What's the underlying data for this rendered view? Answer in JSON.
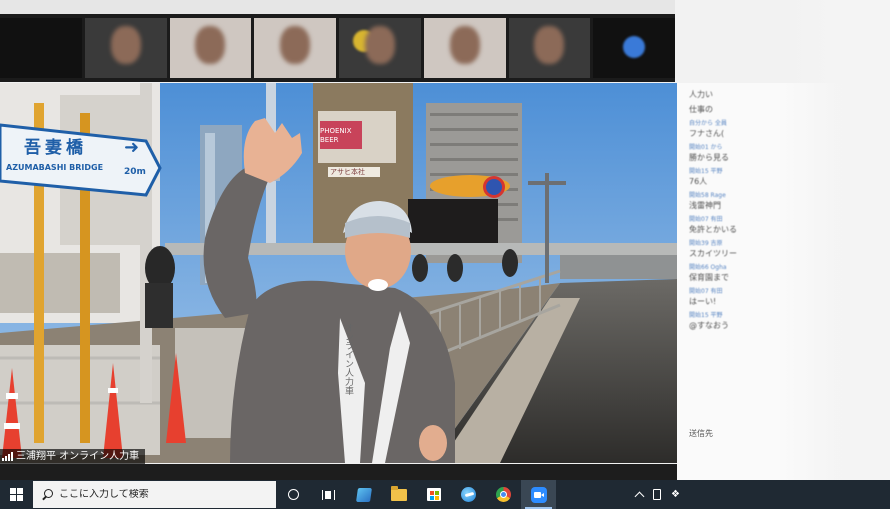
{
  "window": {
    "gallery_tiles": 9
  },
  "video": {
    "participant_name": "三浦翔平 オンライン人力車",
    "signs": {
      "bridge_name_jp": "吾妻橋",
      "bridge_name_en": "AZUMABASHI BRIDGE",
      "distance": "20m",
      "building_sign_1": "PHOENIX BEER",
      "building_sign_2": "アサヒ本社",
      "happi_text": "オンライン人力車"
    }
  },
  "chat": {
    "messages": [
      {
        "from": "",
        "text": "人力い"
      },
      {
        "from": "",
        "text": "仕事の"
      },
      {
        "from": "自分から 全員",
        "text": "フナさん("
      },
      {
        "from": "開始01 から",
        "text": "勝から見る"
      },
      {
        "from": "開始15 平野",
        "text": "76人"
      },
      {
        "from": "開始58 Rage",
        "text": "浅雷神門"
      },
      {
        "from": "開始07 有田",
        "text": "免許とかいる"
      },
      {
        "from": "開始39 吉原",
        "text": "スカイツリー"
      },
      {
        "from": "開始66 Ogha",
        "text": "保育園まで"
      },
      {
        "from": "開始07 有田",
        "text": "はーい!"
      },
      {
        "from": "開始15 平野",
        "text": "@すなおう"
      }
    ],
    "send_to_label": "送信先"
  },
  "taskbar": {
    "search_placeholder": "ここに入力して検索"
  },
  "colors": {
    "taskbar": "#1f2933",
    "zoom_blue": "#2d8cff",
    "chat_link": "#3a6fb8"
  }
}
